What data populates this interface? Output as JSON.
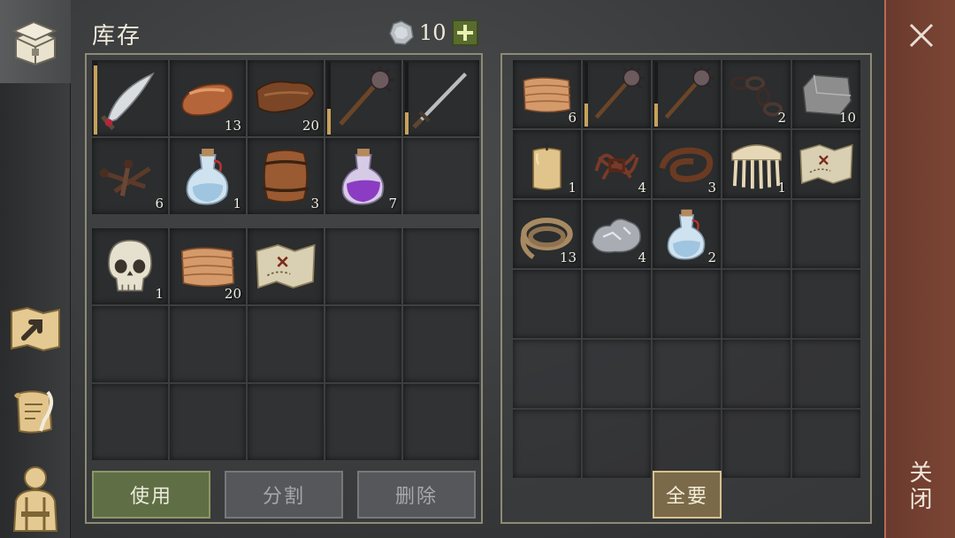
{
  "header": {
    "title": "库存",
    "currency_amount": "10",
    "currency_icon": "silver-coin-icon",
    "add_icon": "plus-icon"
  },
  "sidebar": {
    "tabs": [
      {
        "icon": "chest-icon",
        "active": true
      },
      {
        "icon": "map-icon",
        "active": false
      },
      {
        "icon": "scroll-quill-icon",
        "active": false
      },
      {
        "icon": "character-icon",
        "active": false
      }
    ]
  },
  "inventory": {
    "upper": [
      {
        "icon": "scimitar-icon",
        "qty": "",
        "durability": 0.95
      },
      {
        "icon": "copper-ingot-icon",
        "qty": "13"
      },
      {
        "icon": "leather-icon",
        "qty": "20"
      },
      {
        "icon": "mace-icon",
        "qty": "",
        "durability": 0.35
      },
      {
        "icon": "sword-icon",
        "qty": "",
        "durability": 0.3
      },
      {
        "icon": "nails-icon",
        "qty": "6"
      },
      {
        "icon": "water-flask-icon",
        "qty": "1"
      },
      {
        "icon": "barrel-icon",
        "qty": "3"
      },
      {
        "icon": "purple-potion-icon",
        "qty": "7"
      },
      null
    ],
    "lower": [
      {
        "icon": "skull-icon",
        "qty": "1"
      },
      {
        "icon": "cloth-icon",
        "qty": "20"
      },
      {
        "icon": "treasure-map-icon",
        "qty": ""
      },
      null,
      null,
      null,
      null,
      null,
      null,
      null,
      null,
      null,
      null,
      null,
      null
    ]
  },
  "loot": {
    "items": [
      {
        "icon": "cloth-icon",
        "qty": "6"
      },
      {
        "icon": "mace-icon",
        "qty": "",
        "durability": 0.35
      },
      {
        "icon": "mace-icon",
        "qty": "",
        "durability": 0.35
      },
      {
        "icon": "chain-icon",
        "qty": "2"
      },
      {
        "icon": "stone-block-icon",
        "qty": "10"
      },
      {
        "icon": "candle-icon",
        "qty": "1"
      },
      {
        "icon": "tangled-rope-icon",
        "qty": "4"
      },
      {
        "icon": "leather-strap-icon",
        "qty": "3"
      },
      {
        "icon": "comb-icon",
        "qty": "1"
      },
      {
        "icon": "treasure-map-icon",
        "qty": ""
      },
      {
        "icon": "rope-icon",
        "qty": "13"
      },
      {
        "icon": "iron-ore-icon",
        "qty": "4"
      },
      {
        "icon": "water-flask-icon",
        "qty": "2"
      },
      null,
      null,
      null,
      null,
      null,
      null,
      null
    ],
    "ghost_rows": 2
  },
  "actions": {
    "use": "使用",
    "split": "分割",
    "delete": "删除",
    "take_all": "全要"
  },
  "close": {
    "label": "关闭",
    "icon": "close-icon"
  },
  "colors": {
    "use_button": "#5f6e45",
    "take_all_border": "#d6c28e",
    "close_bar": "#7b4534"
  }
}
